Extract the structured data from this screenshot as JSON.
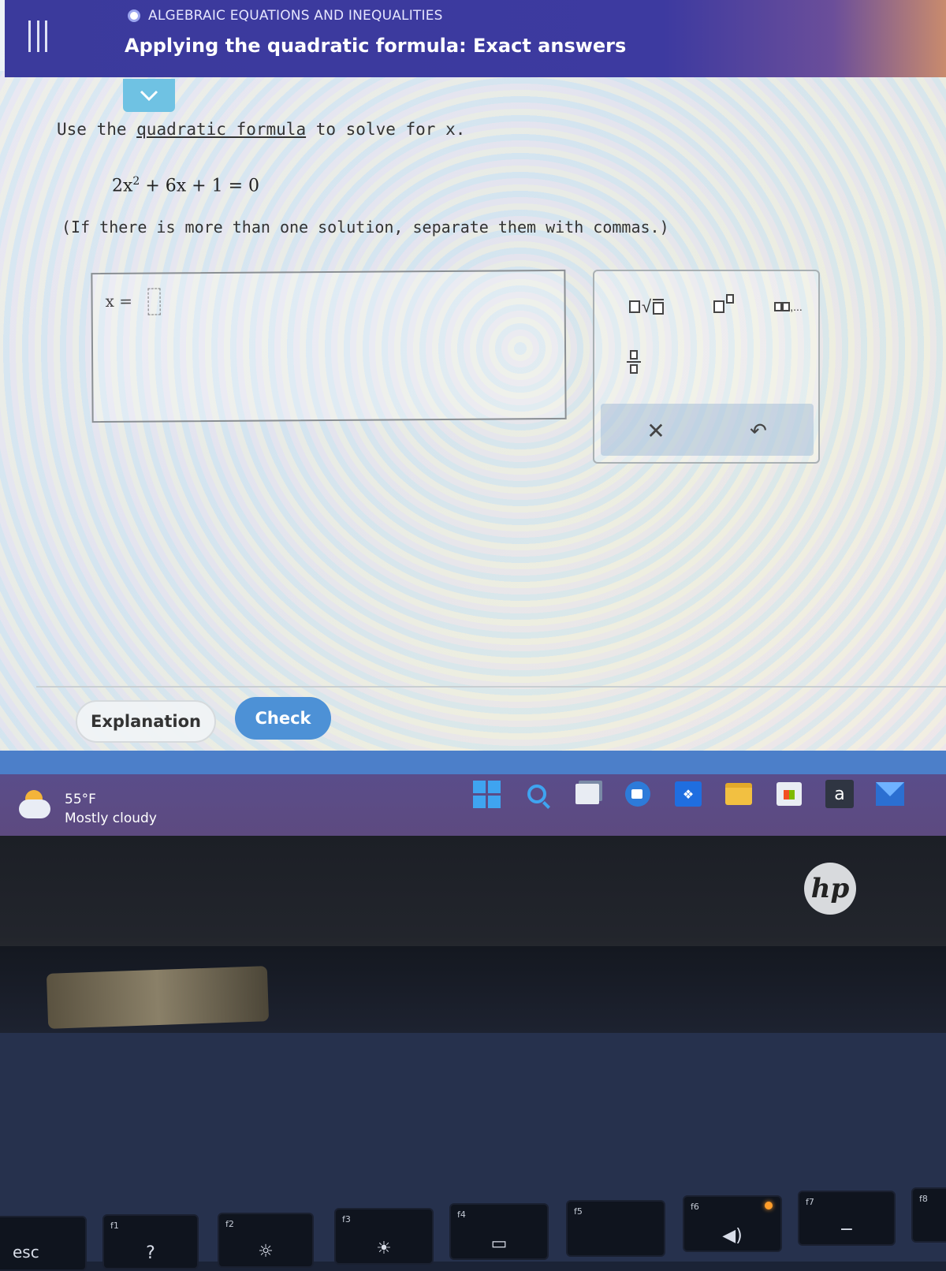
{
  "header": {
    "topic": "ALGEBRAIC EQUATIONS AND INEQUALITIES",
    "title": "Applying the quadratic formula: Exact answers"
  },
  "question": {
    "prompt_before": "Use the ",
    "prompt_link": "quadratic formula",
    "prompt_after": " to solve for x.",
    "equation_a": "2x",
    "equation_exp": "2",
    "equation_rest": " + 6x + 1 = 0",
    "instruction": "(If there is more than one solution, separate them with commas.)"
  },
  "answer": {
    "label": "x =",
    "value": ""
  },
  "palette": {
    "sqrt_label": "√",
    "list_label": ",...",
    "clear_label": "✕",
    "undo_label": "↶"
  },
  "actions": {
    "explanation_label": "Explanation",
    "check_label": "Check"
  },
  "taskbar": {
    "weather_temp": "55°F",
    "weather_desc": "Mostly cloudy",
    "amazon_glyph": "a",
    "dropbox_glyph": "❖"
  },
  "device": {
    "brand": "hp",
    "keys": [
      {
        "sub": "",
        "main": "esc"
      },
      {
        "sub": "f1",
        "main": "?"
      },
      {
        "sub": "f2",
        "main": "☼"
      },
      {
        "sub": "f3",
        "main": "☀"
      },
      {
        "sub": "f4",
        "main": "▭"
      },
      {
        "sub": "f5",
        "main": ""
      },
      {
        "sub": "f6",
        "main": "◀)"
      },
      {
        "sub": "f7",
        "main": "−"
      },
      {
        "sub": "f8",
        "main": ""
      }
    ]
  }
}
